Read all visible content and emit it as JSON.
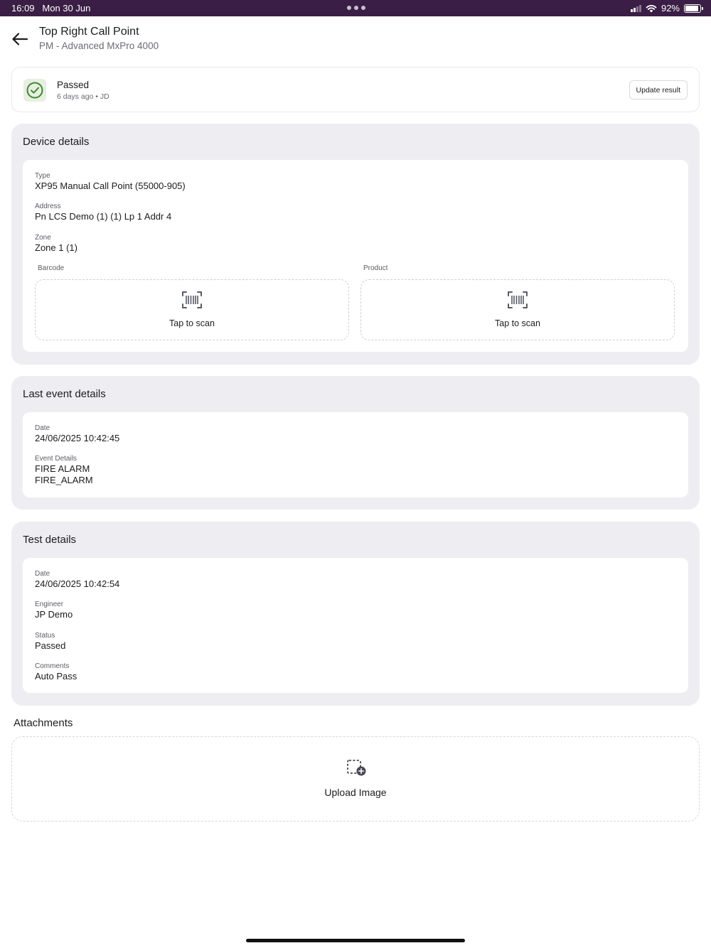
{
  "status_bar": {
    "time": "16:09",
    "date": "Mon 30 Jun",
    "battery": "92%",
    "background_color": "#3a1e45"
  },
  "header": {
    "back_icon": "arrow-left-icon",
    "title": "Top Right Call Point",
    "subtitle": "PM - Advanced MxPro 4000"
  },
  "result": {
    "icon": "check-circle-icon",
    "status": "Passed",
    "meta": "6 days ago • JD",
    "update_button": "Update result",
    "status_color": "#3f8a2a"
  },
  "device_details": {
    "title": "Device details",
    "type_label": "Type",
    "type_value": "XP95 Manual Call Point (55000-905)",
    "address_label": "Address",
    "address_value": "Pn LCS Demo (1) (1) Lp 1 Addr 4",
    "zone_label": "Zone",
    "zone_value": "Zone 1 (1)",
    "barcode_label": "Barcode",
    "barcode_action": "Tap to scan",
    "product_label": "Product",
    "product_action": "Tap to scan"
  },
  "last_event": {
    "title": "Last event details",
    "date_label": "Date",
    "date_value": "24/06/2025 10:42:45",
    "event_label": "Event Details",
    "event_line1": "FIRE ALARM",
    "event_line2": "FIRE_ALARM"
  },
  "test_details": {
    "title": "Test details",
    "date_label": "Date",
    "date_value": "24/06/2025 10:42:54",
    "engineer_label": "Engineer",
    "engineer_value": "JP Demo",
    "status_label": "Status",
    "status_value": "Passed",
    "comments_label": "Comments",
    "comments_value": "Auto Pass"
  },
  "attachments": {
    "title": "Attachments",
    "upload_label": "Upload Image",
    "upload_icon": "image-add-icon"
  }
}
